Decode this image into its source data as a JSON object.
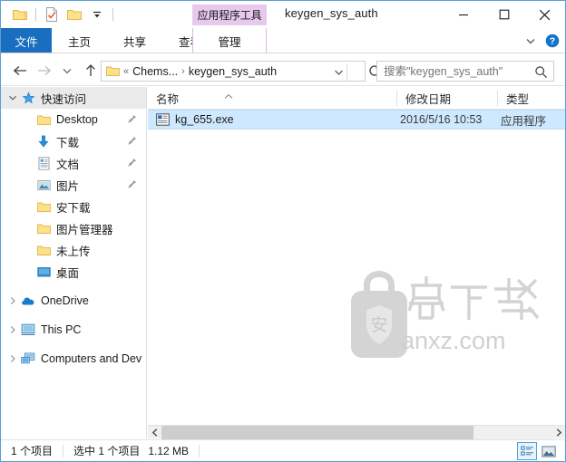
{
  "window": {
    "title": "keygen_sys_auth",
    "contextual_tab_label": "应用程序工具",
    "minimize_icon": "minimize-icon",
    "maximize_icon": "maximize-icon",
    "close_icon": "close-icon"
  },
  "quick_access_toolbar": {
    "items": [
      {
        "name": "properties-folder-icon",
        "label": ""
      },
      {
        "name": "new-folder-checklist-icon",
        "label": ""
      },
      {
        "name": "folder-icon",
        "label": ""
      },
      {
        "name": "customize-dropdown-icon",
        "label": ""
      }
    ]
  },
  "ribbon": {
    "tabs": [
      {
        "label": "文件",
        "state": "active-file"
      },
      {
        "label": "主页",
        "state": "normal"
      },
      {
        "label": "共享",
        "state": "normal"
      },
      {
        "label": "查看",
        "state": "normal"
      },
      {
        "label": "管理",
        "state": "contextual"
      }
    ],
    "collapse_icon": "chevron-up-icon",
    "options_icon": "chevron-down-icon",
    "help_icon": "help-icon",
    "accent_color": "#1a6ec0",
    "contextual_color": "#e8c9ee"
  },
  "address_bar": {
    "back_icon": "arrow-left-icon",
    "forward_icon": "arrow-right-icon",
    "recent_icon": "chevron-down-icon",
    "up_icon": "arrow-up-icon",
    "folder_icon": "folder-icon",
    "overflow": "«",
    "crumbs": [
      {
        "label": "Chems...",
        "separator": "›"
      },
      {
        "label": "keygen_sys_auth",
        "separator": ""
      }
    ],
    "dropdown_icon": "chevron-down-icon",
    "refresh_icon": "refresh-icon"
  },
  "search": {
    "placeholder": "搜索\"keygen_sys_auth\"",
    "value": "",
    "icon": "search-icon"
  },
  "sidebar": {
    "groups": [
      {
        "label": "快速访问",
        "icon": "star-pin-icon",
        "expander": "chevron-down-icon",
        "selected": true,
        "items": [
          {
            "label": "Desktop",
            "icon": "folder-icon",
            "pinned": true
          },
          {
            "label": "下载",
            "icon": "download-arrow-icon",
            "pinned": true
          },
          {
            "label": "文档",
            "icon": "documents-icon",
            "pinned": true
          },
          {
            "label": "图片",
            "icon": "pictures-icon",
            "pinned": true
          },
          {
            "label": "安下载",
            "icon": "folder-icon",
            "pinned": false
          },
          {
            "label": "图片管理器",
            "icon": "folder-icon",
            "pinned": false
          },
          {
            "label": "未上传",
            "icon": "folder-icon",
            "pinned": false
          },
          {
            "label": "桌面",
            "icon": "desktop-icon",
            "pinned": false
          }
        ]
      },
      {
        "label": "OneDrive",
        "icon": "onedrive-cloud-icon",
        "expander": "chevron-right-icon",
        "selected": false,
        "items": []
      },
      {
        "label": "This PC",
        "icon": "this-pc-icon",
        "expander": "chevron-right-icon",
        "selected": false,
        "items": []
      },
      {
        "label": "Computers and Dev",
        "icon": "network-computers-icon",
        "expander": "chevron-right-icon",
        "selected": false,
        "items": []
      }
    ]
  },
  "file_list": {
    "columns": [
      {
        "label": "名称",
        "sorted": "asc",
        "sort_icon": "caret-up-icon"
      },
      {
        "label": "修改日期",
        "sorted": ""
      },
      {
        "label": "类型",
        "sorted": ""
      }
    ],
    "rows": [
      {
        "name": "kg_655.exe",
        "date_modified": "2016/5/16 10:53",
        "type": "应用程序",
        "icon": "exe-application-icon",
        "selected": true
      }
    ],
    "selection_color": "#cde8ff"
  },
  "watermark": {
    "logo_icon": "anxz-bag-shield-icon",
    "shield_char": "安",
    "cn_text": "安下载",
    "domain_text": "anxz.com",
    "color": "#d0d0d0"
  },
  "scrollbar": {
    "left_arrow_icon": "chevron-left-icon",
    "right_arrow_icon": "chevron-right-icon"
  },
  "status_bar": {
    "item_count": "1 个项目",
    "selection": "选中 1 个项目",
    "selection_size": "1.12 MB",
    "views": [
      {
        "name": "details-view-button",
        "icon": "details-view-icon",
        "selected": true
      },
      {
        "name": "large-icons-view-button",
        "icon": "large-icons-view-icon",
        "selected": false
      }
    ]
  }
}
